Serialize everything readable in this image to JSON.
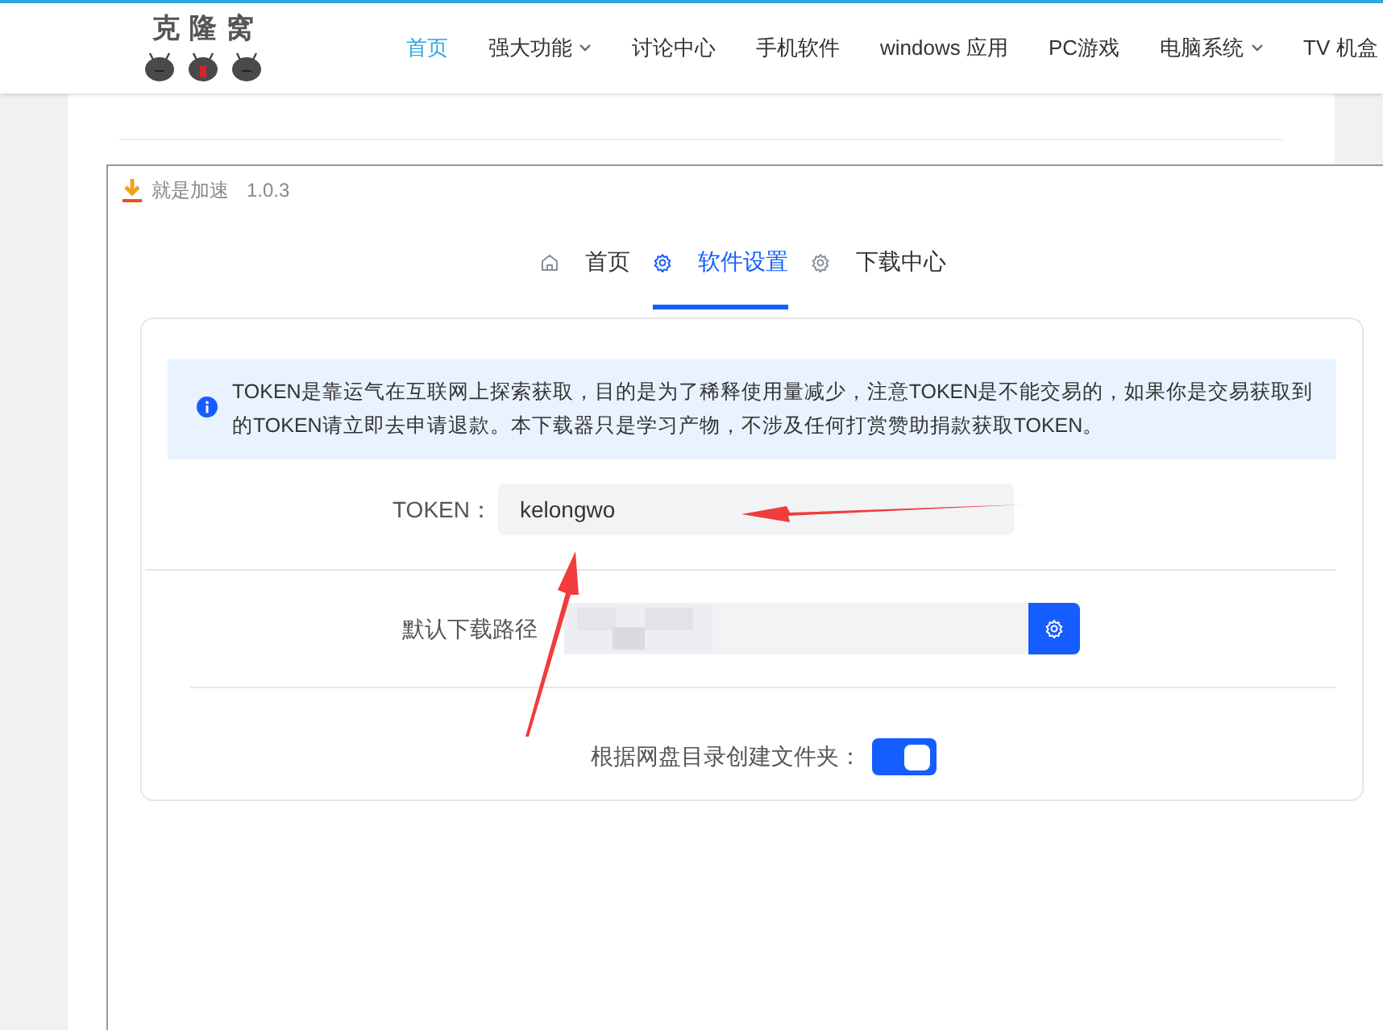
{
  "site": {
    "logo_text": "克 隆 窝",
    "nav": [
      {
        "label": "首页",
        "selected": true,
        "dropdown": false
      },
      {
        "label": "强大功能",
        "selected": false,
        "dropdown": true
      },
      {
        "label": "讨论中心",
        "selected": false,
        "dropdown": false
      },
      {
        "label": "手机软件",
        "selected": false,
        "dropdown": false
      },
      {
        "label": "windows 应用",
        "selected": false,
        "dropdown": false
      },
      {
        "label": "PC游戏",
        "selected": false,
        "dropdown": false
      },
      {
        "label": "电脑系统",
        "selected": false,
        "dropdown": true
      },
      {
        "label": "TV 机盒",
        "selected": false,
        "dropdown": false
      }
    ]
  },
  "window": {
    "title": "就是加速",
    "version": "1.0.3"
  },
  "tabs": [
    {
      "label": "首页",
      "kind": "home",
      "selected": false
    },
    {
      "label": "软件设置",
      "kind": "gear",
      "selected": true
    },
    {
      "label": "下载中心",
      "kind": "gear",
      "selected": false
    }
  ],
  "notice": "TOKEN是靠运气在互联网上探索获取，目的是为了稀释使用量减少，注意TOKEN是不能交易的，如果你是交易获取到的TOKEN请立即去申请退款。本下载器只是学习产物，不涉及任何打赏赞助捐款获取TOKEN。",
  "settings": [
    {
      "kind": "text",
      "label": "TOKEN：",
      "value": "kelongwo"
    },
    {
      "kind": "path",
      "label": "默认下载路径"
    },
    {
      "kind": "switch",
      "label": "根据网盘目录创建文件夹：",
      "on": true
    }
  ]
}
